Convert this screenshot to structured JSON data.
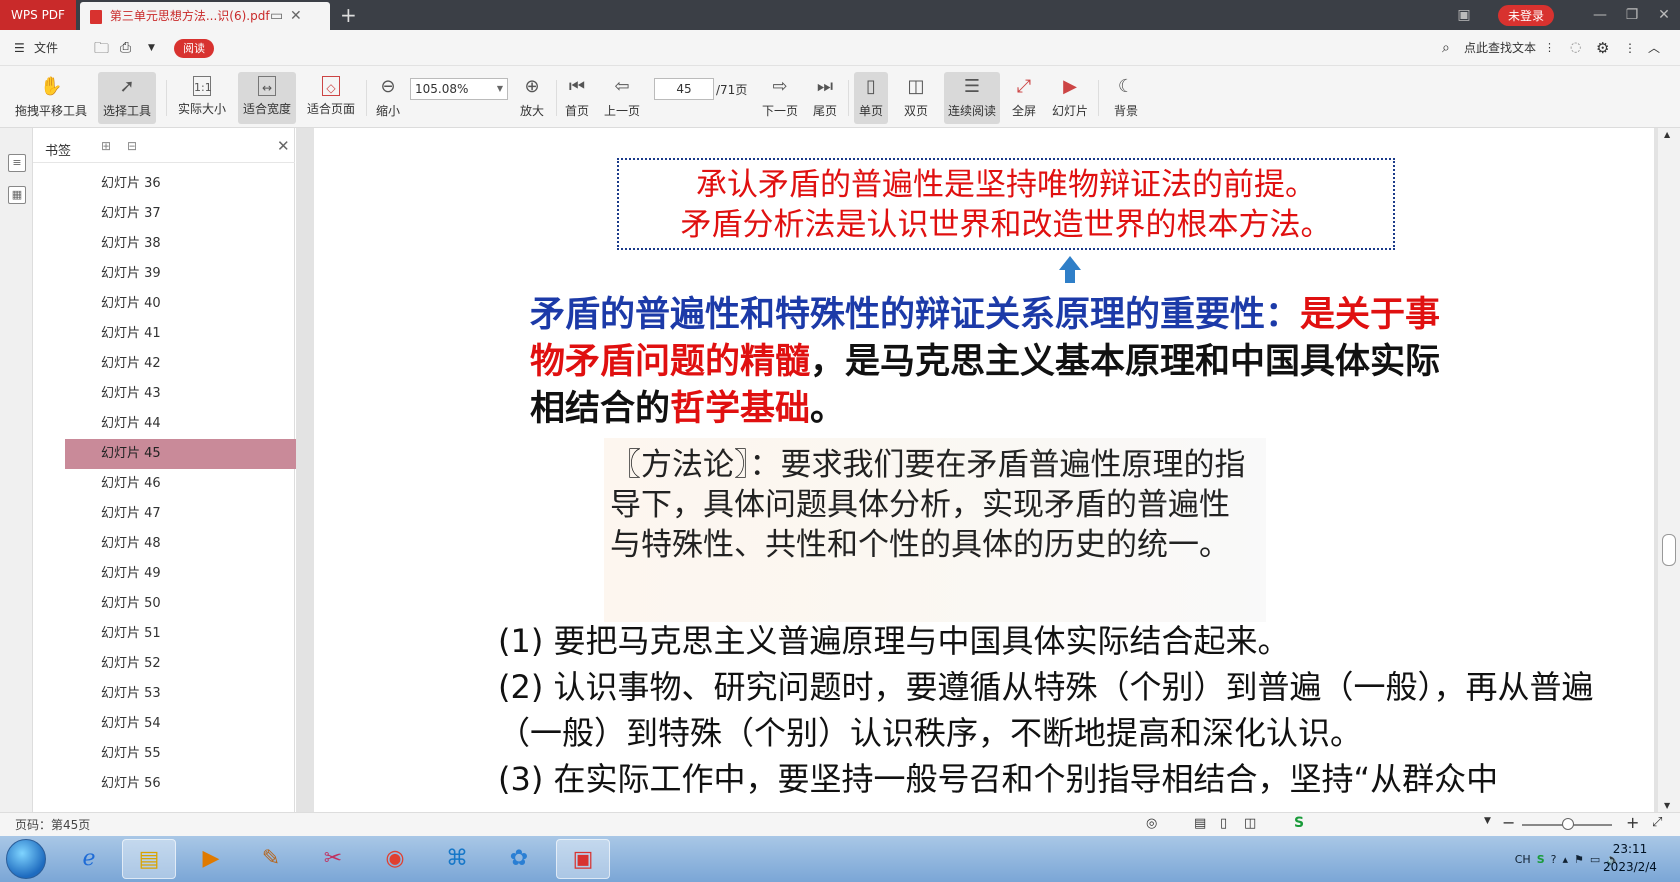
{
  "window": {
    "app_name": "WPS PDF",
    "doc_tab_title": "第三单元思想方法...识(6).pdf",
    "login_label": "未登录"
  },
  "menubar": {
    "file_label": "文件",
    "read_badge": "阅读",
    "find_label": "点此查找文本"
  },
  "toolbar": {
    "hand_tool": "拖拽平移工具",
    "select_tool": "选择工具",
    "actual_size": "实际大小",
    "fit_width": "适合宽度",
    "fit_page": "适合页面",
    "zoom_out": "缩小",
    "zoom_value": "105.08%",
    "zoom_in": "放大",
    "first_page": "首页",
    "prev_page": "上一页",
    "current_page": "45",
    "total_pages": "/71页",
    "next_page": "下一页",
    "last_page": "尾页",
    "single_page": "单页",
    "double_page": "双页",
    "continuous": "连续阅读",
    "fullscreen": "全屏",
    "slideshow": "幻灯片",
    "background": "背景"
  },
  "bookmarks": {
    "title": "书签",
    "selected_index": 9,
    "items": [
      "幻灯片 36",
      "幻灯片 37",
      "幻灯片 38",
      "幻灯片 39",
      "幻灯片 40",
      "幻灯片 41",
      "幻灯片 42",
      "幻灯片 43",
      "幻灯片 44",
      "幻灯片 45",
      "幻灯片 46",
      "幻灯片 47",
      "幻灯片 48",
      "幻灯片 49",
      "幻灯片 50",
      "幻灯片 51",
      "幻灯片 52",
      "幻灯片 53",
      "幻灯片 54",
      "幻灯片 55",
      "幻灯片 56"
    ]
  },
  "slide": {
    "principle_line1": "承认矛盾的普遍性是坚持唯物辩证法的前提。",
    "principle_line2": "矛盾分析法是认识世界和改造世界的根本方法。",
    "importance_blue": "矛盾的普遍性和特殊性的辩证关系原理的重要性：",
    "importance_red1": "是关于事物矛盾问题的精髓",
    "importance_black1": "，是马克思主义基本原理和中国具体实际相结合的",
    "importance_red2": "哲学基础",
    "importance_black2": "。",
    "method_text": "〖方法论〗：要求我们要在矛盾普遍性原理的指导下，具体问题具体分析，实现矛盾的普遍性与特殊性、共性和个性的具体的历史的统一。",
    "step1": "(1) 要把马克思主义普遍原理与中国具体实际结合起来。",
    "step2": "(2) 认识事物、研究问题时，要遵循从特殊（个别）到普遍（一般），再从普遍（一般）到特殊（个别）认识秩序，不断地提高和深化认识。",
    "step3": "(3) 在实际工作中，要坚持一般号召和个别指导相结合，坚持“从群众中"
  },
  "statusbar": {
    "page_info": "页码：第45页"
  },
  "taskbar": {
    "ime_label": "CH",
    "time": "23:11",
    "date": "2023/2/4"
  },
  "colors": {
    "accent_red": "#d8322f",
    "title_blue": "#1c3aa8",
    "text_red": "#e01010",
    "selected_bookmark": "#c98a99"
  }
}
